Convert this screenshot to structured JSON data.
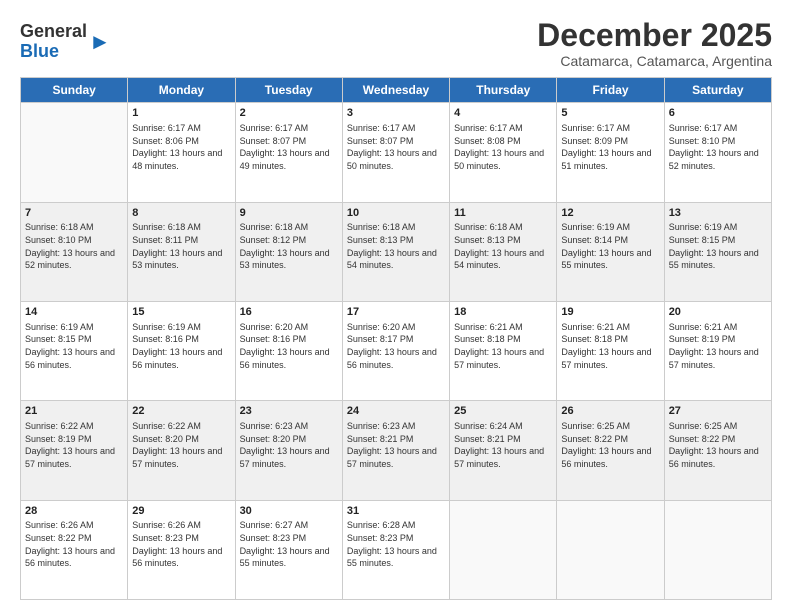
{
  "logo": {
    "general": "General",
    "blue": "Blue"
  },
  "title": "December 2025",
  "subtitle": "Catamarca, Catamarca, Argentina",
  "days": [
    "Sunday",
    "Monday",
    "Tuesday",
    "Wednesday",
    "Thursday",
    "Friday",
    "Saturday"
  ],
  "weeks": [
    [
      {
        "day": "",
        "sunrise": "",
        "sunset": "",
        "daylight": ""
      },
      {
        "day": "1",
        "sunrise": "Sunrise: 6:17 AM",
        "sunset": "Sunset: 8:06 PM",
        "daylight": "Daylight: 13 hours and 48 minutes."
      },
      {
        "day": "2",
        "sunrise": "Sunrise: 6:17 AM",
        "sunset": "Sunset: 8:07 PM",
        "daylight": "Daylight: 13 hours and 49 minutes."
      },
      {
        "day": "3",
        "sunrise": "Sunrise: 6:17 AM",
        "sunset": "Sunset: 8:07 PM",
        "daylight": "Daylight: 13 hours and 50 minutes."
      },
      {
        "day": "4",
        "sunrise": "Sunrise: 6:17 AM",
        "sunset": "Sunset: 8:08 PM",
        "daylight": "Daylight: 13 hours and 50 minutes."
      },
      {
        "day": "5",
        "sunrise": "Sunrise: 6:17 AM",
        "sunset": "Sunset: 8:09 PM",
        "daylight": "Daylight: 13 hours and 51 minutes."
      },
      {
        "day": "6",
        "sunrise": "Sunrise: 6:17 AM",
        "sunset": "Sunset: 8:10 PM",
        "daylight": "Daylight: 13 hours and 52 minutes."
      }
    ],
    [
      {
        "day": "7",
        "sunrise": "Sunrise: 6:18 AM",
        "sunset": "Sunset: 8:10 PM",
        "daylight": "Daylight: 13 hours and 52 minutes."
      },
      {
        "day": "8",
        "sunrise": "Sunrise: 6:18 AM",
        "sunset": "Sunset: 8:11 PM",
        "daylight": "Daylight: 13 hours and 53 minutes."
      },
      {
        "day": "9",
        "sunrise": "Sunrise: 6:18 AM",
        "sunset": "Sunset: 8:12 PM",
        "daylight": "Daylight: 13 hours and 53 minutes."
      },
      {
        "day": "10",
        "sunrise": "Sunrise: 6:18 AM",
        "sunset": "Sunset: 8:13 PM",
        "daylight": "Daylight: 13 hours and 54 minutes."
      },
      {
        "day": "11",
        "sunrise": "Sunrise: 6:18 AM",
        "sunset": "Sunset: 8:13 PM",
        "daylight": "Daylight: 13 hours and 54 minutes."
      },
      {
        "day": "12",
        "sunrise": "Sunrise: 6:19 AM",
        "sunset": "Sunset: 8:14 PM",
        "daylight": "Daylight: 13 hours and 55 minutes."
      },
      {
        "day": "13",
        "sunrise": "Sunrise: 6:19 AM",
        "sunset": "Sunset: 8:15 PM",
        "daylight": "Daylight: 13 hours and 55 minutes."
      }
    ],
    [
      {
        "day": "14",
        "sunrise": "Sunrise: 6:19 AM",
        "sunset": "Sunset: 8:15 PM",
        "daylight": "Daylight: 13 hours and 56 minutes."
      },
      {
        "day": "15",
        "sunrise": "Sunrise: 6:19 AM",
        "sunset": "Sunset: 8:16 PM",
        "daylight": "Daylight: 13 hours and 56 minutes."
      },
      {
        "day": "16",
        "sunrise": "Sunrise: 6:20 AM",
        "sunset": "Sunset: 8:16 PM",
        "daylight": "Daylight: 13 hours and 56 minutes."
      },
      {
        "day": "17",
        "sunrise": "Sunrise: 6:20 AM",
        "sunset": "Sunset: 8:17 PM",
        "daylight": "Daylight: 13 hours and 56 minutes."
      },
      {
        "day": "18",
        "sunrise": "Sunrise: 6:21 AM",
        "sunset": "Sunset: 8:18 PM",
        "daylight": "Daylight: 13 hours and 57 minutes."
      },
      {
        "day": "19",
        "sunrise": "Sunrise: 6:21 AM",
        "sunset": "Sunset: 8:18 PM",
        "daylight": "Daylight: 13 hours and 57 minutes."
      },
      {
        "day": "20",
        "sunrise": "Sunrise: 6:21 AM",
        "sunset": "Sunset: 8:19 PM",
        "daylight": "Daylight: 13 hours and 57 minutes."
      }
    ],
    [
      {
        "day": "21",
        "sunrise": "Sunrise: 6:22 AM",
        "sunset": "Sunset: 8:19 PM",
        "daylight": "Daylight: 13 hours and 57 minutes."
      },
      {
        "day": "22",
        "sunrise": "Sunrise: 6:22 AM",
        "sunset": "Sunset: 8:20 PM",
        "daylight": "Daylight: 13 hours and 57 minutes."
      },
      {
        "day": "23",
        "sunrise": "Sunrise: 6:23 AM",
        "sunset": "Sunset: 8:20 PM",
        "daylight": "Daylight: 13 hours and 57 minutes."
      },
      {
        "day": "24",
        "sunrise": "Sunrise: 6:23 AM",
        "sunset": "Sunset: 8:21 PM",
        "daylight": "Daylight: 13 hours and 57 minutes."
      },
      {
        "day": "25",
        "sunrise": "Sunrise: 6:24 AM",
        "sunset": "Sunset: 8:21 PM",
        "daylight": "Daylight: 13 hours and 57 minutes."
      },
      {
        "day": "26",
        "sunrise": "Sunrise: 6:25 AM",
        "sunset": "Sunset: 8:22 PM",
        "daylight": "Daylight: 13 hours and 56 minutes."
      },
      {
        "day": "27",
        "sunrise": "Sunrise: 6:25 AM",
        "sunset": "Sunset: 8:22 PM",
        "daylight": "Daylight: 13 hours and 56 minutes."
      }
    ],
    [
      {
        "day": "28",
        "sunrise": "Sunrise: 6:26 AM",
        "sunset": "Sunset: 8:22 PM",
        "daylight": "Daylight: 13 hours and 56 minutes."
      },
      {
        "day": "29",
        "sunrise": "Sunrise: 6:26 AM",
        "sunset": "Sunset: 8:23 PM",
        "daylight": "Daylight: 13 hours and 56 minutes."
      },
      {
        "day": "30",
        "sunrise": "Sunrise: 6:27 AM",
        "sunset": "Sunset: 8:23 PM",
        "daylight": "Daylight: 13 hours and 55 minutes."
      },
      {
        "day": "31",
        "sunrise": "Sunrise: 6:28 AM",
        "sunset": "Sunset: 8:23 PM",
        "daylight": "Daylight: 13 hours and 55 minutes."
      },
      {
        "day": "",
        "sunrise": "",
        "sunset": "",
        "daylight": ""
      },
      {
        "day": "",
        "sunrise": "",
        "sunset": "",
        "daylight": ""
      },
      {
        "day": "",
        "sunrise": "",
        "sunset": "",
        "daylight": ""
      }
    ]
  ]
}
